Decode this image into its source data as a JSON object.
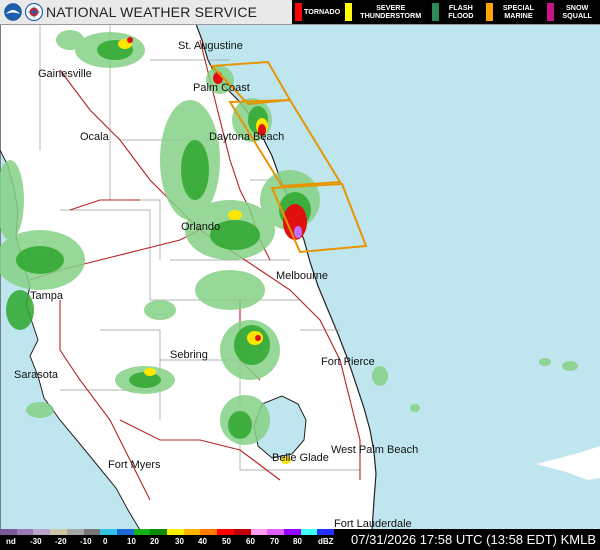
{
  "header": {
    "title": "NATIONAL WEATHER SERVICE",
    "legend": [
      {
        "label": "TORNADO",
        "color": "#ff0000"
      },
      {
        "label": "SEVERE THUNDERSTORM",
        "color": "#ffff00"
      },
      {
        "label": "FLASH FLOOD",
        "color": "#2e8b57"
      },
      {
        "label": "SPECIAL MARINE",
        "color": "#ffa500"
      },
      {
        "label": "SNOW SQUALL",
        "color": "#c71585"
      }
    ]
  },
  "cities": [
    {
      "name": "St. Augustine"
    },
    {
      "name": "Gainesville"
    },
    {
      "name": "Palm Coast"
    },
    {
      "name": "Ocala"
    },
    {
      "name": "Daytona Beach"
    },
    {
      "name": "Orlando"
    },
    {
      "name": "Melbourne"
    },
    {
      "name": "Tampa"
    },
    {
      "name": "Sarasota"
    },
    {
      "name": "Sebring"
    },
    {
      "name": "Fort Pierce"
    },
    {
      "name": "West Palm Beach"
    },
    {
      "name": "Fort Myers"
    },
    {
      "name": "Belle Glade"
    },
    {
      "name": "Fort Lauderdale"
    }
  ],
  "scale": {
    "labels": [
      "nd",
      "-30",
      "-20",
      "-10",
      "0",
      "10",
      "20",
      "30",
      "40",
      "50",
      "60",
      "70",
      "80",
      "dBZ"
    ],
    "colors": [
      "#7a5a9a",
      "#9a7ab6",
      "#b8a2cc",
      "#ccc6a4",
      "#a6a6a6",
      "#767676",
      "#34c2e4",
      "#1e66d4",
      "#16b216",
      "#0a8a0a",
      "#fff200",
      "#ffb400",
      "#ff7a00",
      "#ff0000",
      "#c00000",
      "#ff9ef0",
      "#e060ff",
      "#9000ff",
      "#3fffff",
      "#2030ff"
    ]
  },
  "footer": {
    "timestamp": "07/31/2026 17:58 UTC (13:58 EDT) KMLB"
  }
}
